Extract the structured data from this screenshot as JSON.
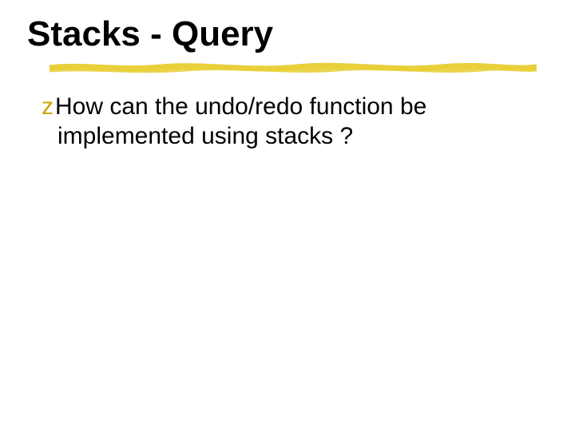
{
  "slide": {
    "title": "Stacks - Query",
    "underline_color": "#e9cf3a",
    "bullet": {
      "glyph": "z",
      "glyph_color": "#c9a500",
      "line1": "How can the undo/redo function be",
      "line2": "implemented using stacks ?"
    }
  }
}
